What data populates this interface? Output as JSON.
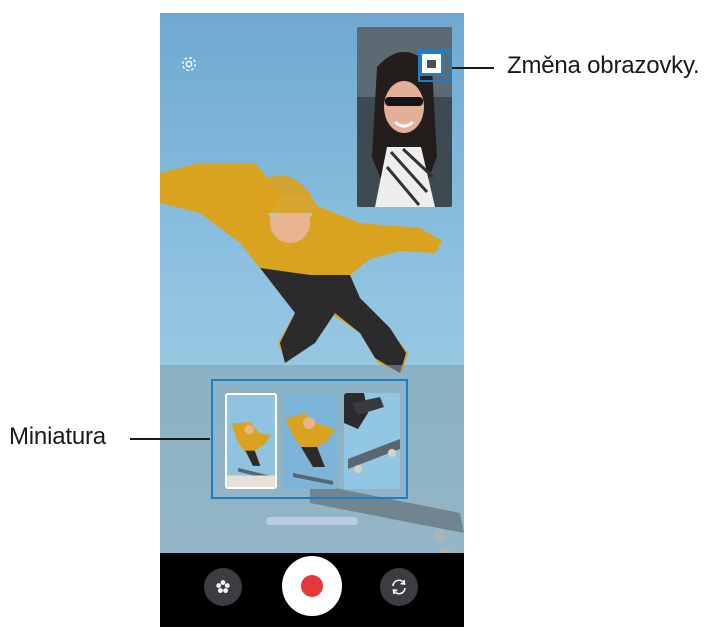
{
  "annotations": {
    "switch_screen_label": "Změna obrazovky.",
    "thumbnail_label": "Miniatura"
  },
  "screen": {
    "settings_icon": "gear-icon",
    "pip_switch_icon": "screen-switch-icon",
    "bottom_bar": {
      "effects_icon": "flower-icon",
      "record_icon": "record-icon",
      "switch_camera_icon": "rotate-camera-icon"
    }
  },
  "colors": {
    "highlight": "#1a7ec8",
    "record": "#e5383b"
  }
}
